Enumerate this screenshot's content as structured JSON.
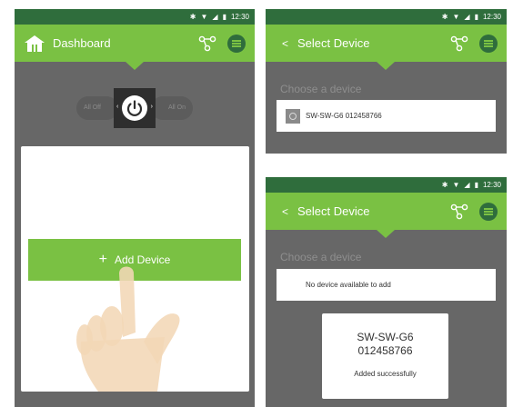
{
  "status": {
    "time": "12:30"
  },
  "dashboard": {
    "title": "Dashboard",
    "all_off": "All Off",
    "all_on": "All On",
    "add_device": "Add Device"
  },
  "select_top": {
    "back": "<",
    "title": "Select Device",
    "choose_label": "Choose a device",
    "device_name": "SW-SW-G6 012458766"
  },
  "select_bottom": {
    "back": "<",
    "title": "Select Device",
    "choose_label": "Choose a device",
    "no_device": "No device available to add",
    "toast_line1": "SW-SW-G6",
    "toast_line2": "012458766",
    "toast_message": "Added successfully"
  },
  "colors": {
    "green": "#7ac143",
    "dark_green": "#2f6d3c",
    "gray_bg": "#676767"
  },
  "icons": [
    "bluetooth-icon",
    "wifi-icon",
    "signal-icon",
    "battery-icon",
    "home-logo-icon",
    "share-icon",
    "menu-icon",
    "power-icon",
    "plus-icon",
    "device-icon",
    "hand-pointer-icon"
  ]
}
